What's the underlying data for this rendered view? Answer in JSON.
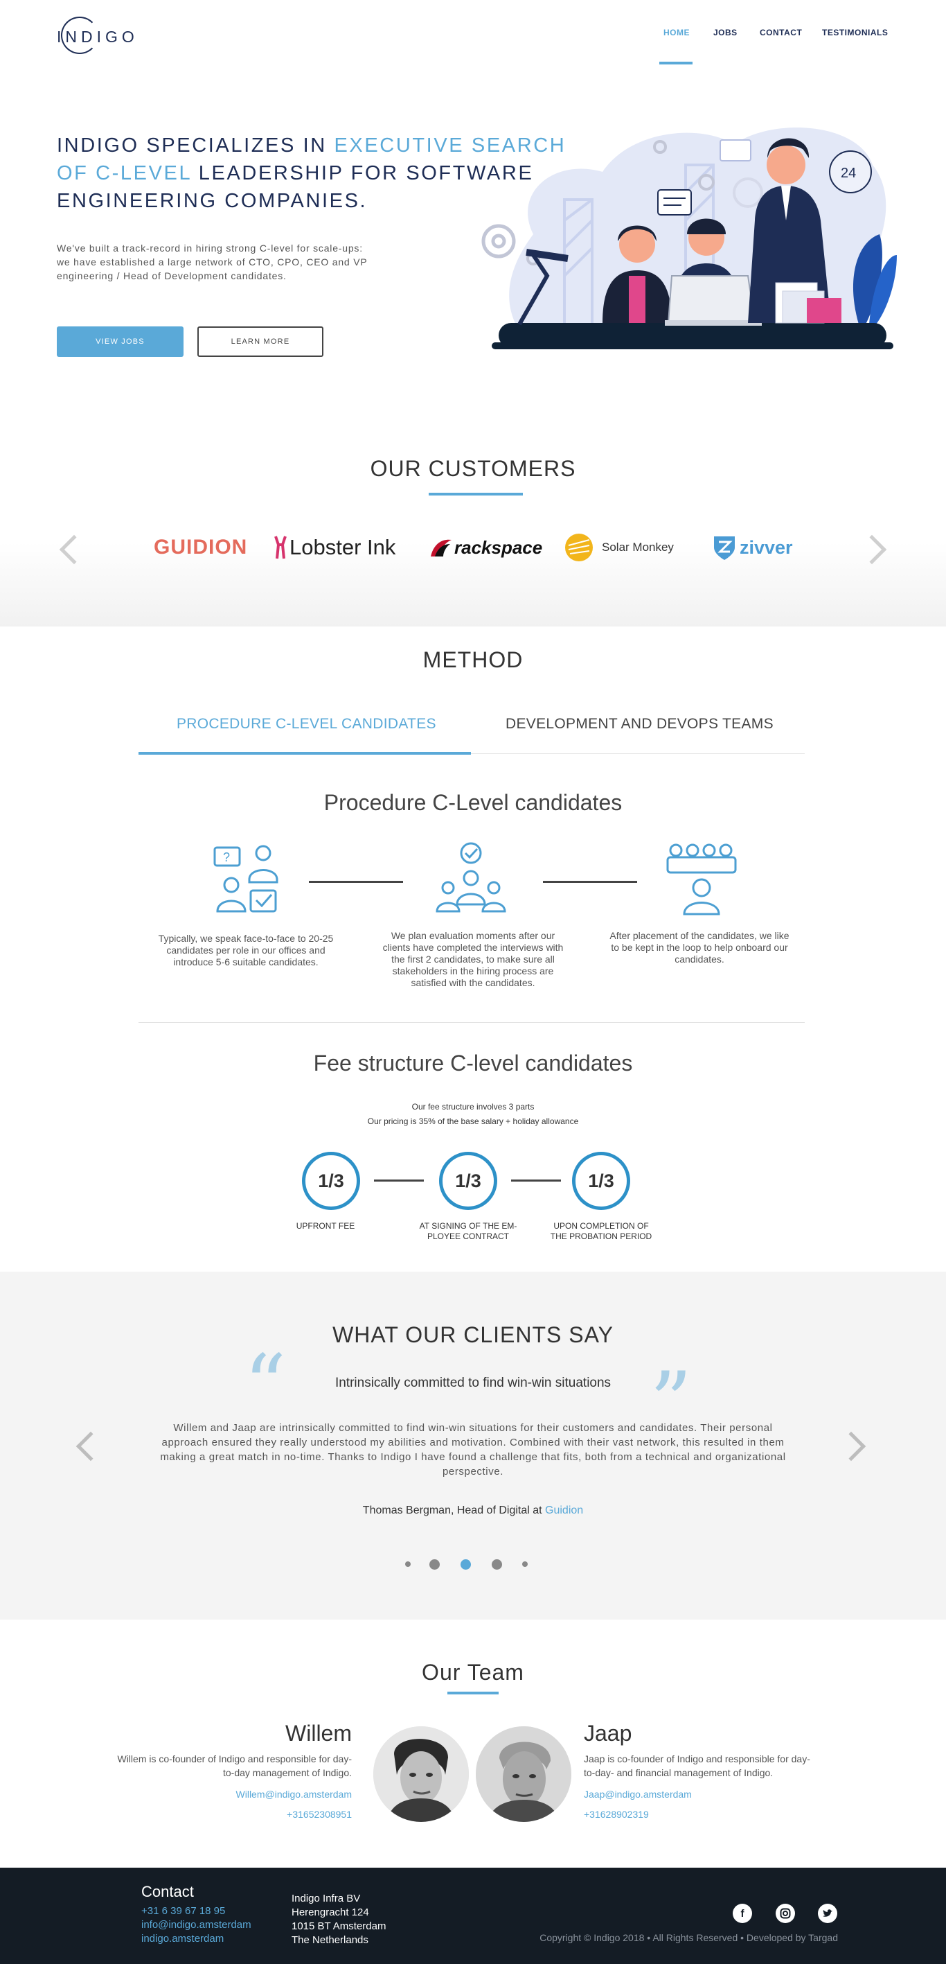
{
  "nav": {
    "logo": "INDIGO",
    "items": [
      {
        "label": "HOME",
        "active": true
      },
      {
        "label": "JOBS",
        "active": false
      },
      {
        "label": "CONTACT",
        "active": false
      },
      {
        "label": "TESTIMONIALS",
        "active": false
      }
    ]
  },
  "hero": {
    "title_part1": "INDIGO SPECIALIZES IN ",
    "title_highlight": "EXECUTIVE SEARCH OF C-LEVEL",
    "title_part2": " LEADERSHIP FOR SOFTWARE ENGINEERING COMPANIES.",
    "description": "We've built a track-record in hiring strong C-level for scale-ups: we have established a large network of CTO, CPO, CEO and VP engineering / Head of Development candidates.",
    "btn_jobs": "VIEW JOBS",
    "btn_learn": "LEARN MORE",
    "badge_24": "24"
  },
  "customers": {
    "title": "OUR CUSTOMERS",
    "logos": [
      "GUIDION",
      "Lobster Ink",
      "rackspace",
      "Solar Monkey",
      "zivver"
    ]
  },
  "method": {
    "title": "METHOD",
    "tabs": [
      {
        "label": "PROCEDURE C-LEVEL CANDIDATES",
        "active": true
      },
      {
        "label": "DEVELOPMENT AND DEVOPS TEAMS",
        "active": false
      }
    ],
    "procedure_title": "Procedure C-Level candidates",
    "steps": [
      {
        "text": "Typically, we speak face-to-face to 20-25 candidates per role in our offices and introduce 5-6 suitable candidates."
      },
      {
        "text": "We plan evaluation moments after our clients have completed the interviews with the first 2 candidates, to make sure all stakeholders in the hiring process are satisfied with the candidates."
      },
      {
        "text": "After placement of the candidates, we like to be kept in the loop to help onboard our candidates."
      }
    ],
    "fee_title": "Fee structure C-level candidates",
    "fee_intro_1": "Our fee structure involves 3 parts",
    "fee_intro_2": "Our pricing is 35% of the base salary + holiday allowance",
    "fees": [
      {
        "value": "1/3",
        "label": "UPFRONT FEE"
      },
      {
        "value": "1/3",
        "label": "AT SIGNING OF THE EM-PLOYEE CONTRACT"
      },
      {
        "value": "1/3",
        "label": "UPON COMPLETION OF THE PROBATION PERIOD"
      }
    ]
  },
  "testimonials": {
    "title": "WHAT OUR CLIENTS SAY",
    "headline": "Intrinsically committed to find win-win situations",
    "body": "Willem and Jaap are intrinsically committed to find win-win situations for their customers and candidates. Their personal approach ensured they really understood my abilities and motivation. Combined with their vast network, this resulted in them making a great match in no-time. Thanks to Indigo I have found a challenge that fits, both from a technical and organizational perspective.",
    "author": "Thomas Bergman, Head of Digital at ",
    "author_company": "Guidion",
    "active_dot": 2
  },
  "team": {
    "title": "Our Team",
    "members": [
      {
        "name": "Willem",
        "bio": "Willem is co-founder of Indigo and responsible for day-to-day management of Indigo.",
        "email": "Willem@indigo.amsterdam",
        "phone": "+31652308951"
      },
      {
        "name": "Jaap",
        "bio": "Jaap is co-founder of Indigo and responsible for day-to-day- and financial management of Indigo.",
        "email": "Jaap@indigo.amsterdam",
        "phone": "+31628902319"
      }
    ]
  },
  "footer": {
    "contact_title": "Contact",
    "phone": "+31 6 39 67 18 95",
    "email": "info@indigo.amsterdam",
    "website": "indigo.amsterdam",
    "address": [
      "Indigo Infra BV",
      "Herengracht 124",
      "1015 BT Amsterdam",
      "The Netherlands"
    ],
    "socials": [
      "facebook-icon",
      "instagram-icon",
      "twitter-icon"
    ],
    "copyright": "Copyright © Indigo 2018 • All Rights Reserved • Developed by Targad"
  },
  "colors": {
    "accent": "#5aa9d8",
    "navy": "#1e2d55",
    "footer_bg": "#141c25",
    "fee_circle": "#2d91c8"
  }
}
